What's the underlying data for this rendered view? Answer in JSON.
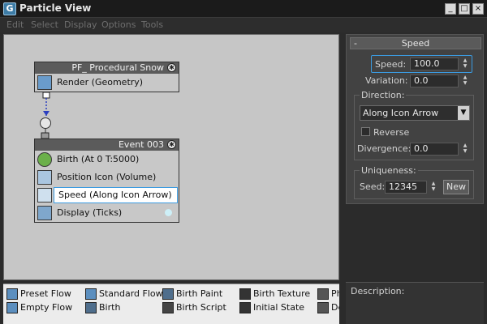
{
  "window": {
    "title": "Particle View",
    "minimize": "_",
    "maximize": "□",
    "close": "×"
  },
  "menu": [
    "Edit",
    "Select",
    "Display",
    "Options",
    "Tools"
  ],
  "flow_node": {
    "title": "PF_ Procedural Snow",
    "operators": [
      {
        "label": "Render (Geometry)",
        "icon": "render-icon"
      }
    ]
  },
  "event_node": {
    "title": "Event 003",
    "operators": [
      {
        "label": "Birth  (At 0 T:5000)",
        "icon": "birth-icon"
      },
      {
        "label": "Position Icon (Volume)",
        "icon": "position-icon"
      },
      {
        "label": "Speed  (Along Icon Arrow)",
        "icon": "speed-icon"
      },
      {
        "label": "Display  (Ticks)",
        "icon": "display-icon"
      }
    ]
  },
  "speed_panel": {
    "rollout_title": "Speed",
    "rollout_toggle": "-",
    "speed_label": "Speed:",
    "speed_value": "100.0",
    "variation_label": "Variation:",
    "variation_value": "0.0",
    "direction_group": "Direction:",
    "direction_value": "Along Icon Arrow",
    "reverse_label": "Reverse",
    "reverse_checked": false,
    "divergence_label": "Divergence:",
    "divergence_value": "0.0",
    "uniqueness_group": "Uniqueness:",
    "seed_label": "Seed:",
    "seed_value": "12345",
    "new_button": "New"
  },
  "description": {
    "label": "Description:"
  },
  "depot": {
    "col1": [
      "Preset Flow",
      "Empty Flow"
    ],
    "col2": [
      "Standard Flow",
      "Birth"
    ],
    "col3": [
      "Birth Paint",
      "Birth Script"
    ],
    "col4": [
      "Birth Texture",
      "Initial State"
    ],
    "col5": [
      "Ph",
      "De"
    ]
  },
  "colors": {
    "accent": "#3b9be0",
    "canvas": "#c6c6c6",
    "panel": "#424242"
  }
}
